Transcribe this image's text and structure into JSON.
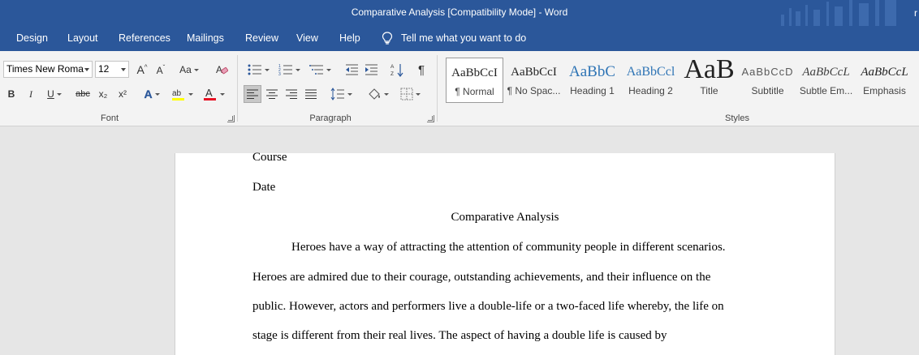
{
  "window": {
    "title": "Comparative Analysis [Compatibility Mode]  -  Word",
    "user_initial": "r"
  },
  "menu": {
    "tabs": [
      "Design",
      "Layout",
      "References",
      "Mailings",
      "Review",
      "View",
      "Help"
    ],
    "tell_me": "Tell me what you want to do"
  },
  "ribbon": {
    "font": {
      "font_name": "Times New Roma",
      "font_size": "12",
      "group_label": "Font",
      "buttons": {
        "bold": "B",
        "italic": "I",
        "underline": "U",
        "strike": "abc",
        "subscript": "x₂",
        "superscript": "x²",
        "change_case": "Aa"
      },
      "highlight_color": "#ffff00",
      "font_color": "#e81123"
    },
    "paragraph": {
      "group_label": "Paragraph"
    },
    "styles": {
      "group_label": "Styles",
      "items": [
        {
          "sample": "AaBbCcI",
          "name": "¶ Normal"
        },
        {
          "sample": "AaBbCcI",
          "name": "¶ No Spac..."
        },
        {
          "sample": "AaBbC",
          "name": "Heading 1"
        },
        {
          "sample": "AaBbCcl",
          "name": "Heading 2"
        },
        {
          "sample": "AaB",
          "name": "Title"
        },
        {
          "sample": "AaBbCcD",
          "name": "Subtitle"
        },
        {
          "sample": "AaBbCcL",
          "name": "Subtle Em..."
        },
        {
          "sample": "AaBbCcL",
          "name": "Emphasis"
        }
      ]
    }
  },
  "document": {
    "lines": [
      "Course",
      "Date",
      "Comparative Analysis",
      "Heroes have a way of attracting the attention of community people in different scenarios.",
      "Heroes are admired due to their courage, outstanding achievements, and their influence on the",
      "public. However, actors and performers live a double-life or a two-faced life whereby, the life on",
      "stage is different from their real lives. The aspect of having a double life is caused by"
    ]
  },
  "colors": {
    "title_bar": "#2b579a",
    "ribbon": "#f3f3f3",
    "canvas": "#e6e6e6",
    "heading_blue": "#2e74b5"
  }
}
